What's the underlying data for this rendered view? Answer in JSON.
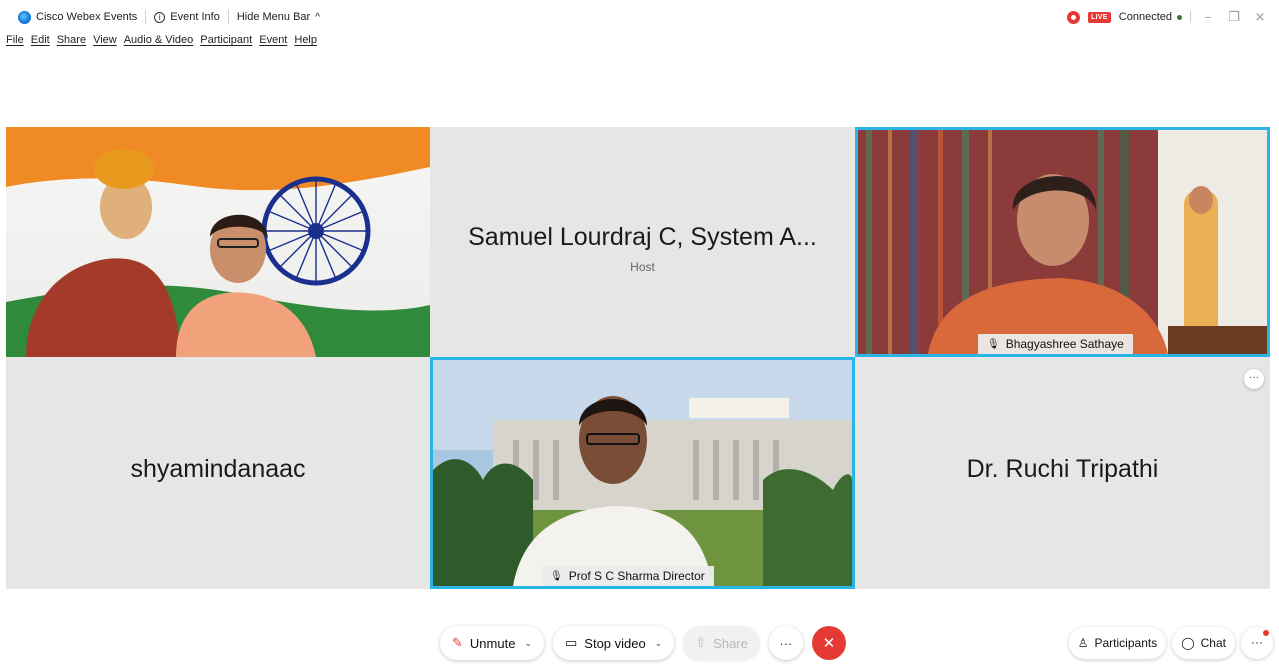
{
  "titlebar": {
    "app_name": "Cisco Webex Events",
    "event_info": "Event Info",
    "hide_menu_bar": "Hide Menu Bar",
    "live": "LIVE",
    "status": "Connected"
  },
  "menu": [
    "File",
    "Edit",
    "Share",
    "View",
    "Audio & Video",
    "Participant",
    "Event",
    "Help"
  ],
  "tiles": {
    "top_center": {
      "name": "Samuel Lourdraj C, System A...",
      "role": "Host"
    },
    "top_right": {
      "name": "Bhagyashree Sathaye"
    },
    "bottom_left": {
      "name": "shyamindanaac"
    },
    "bottom_center": {
      "name": "Prof  S C Sharma Director"
    },
    "bottom_right": {
      "name": "Dr. Ruchi Tripathi"
    }
  },
  "controls": {
    "unmute": "Unmute",
    "stop_video": "Stop video",
    "share": "Share"
  },
  "right_controls": {
    "participants": "Participants",
    "chat": "Chat"
  },
  "colors": {
    "active_border": "#29b6e6",
    "end_call": "#e53935",
    "tile_bg": "#e6e6e6"
  }
}
